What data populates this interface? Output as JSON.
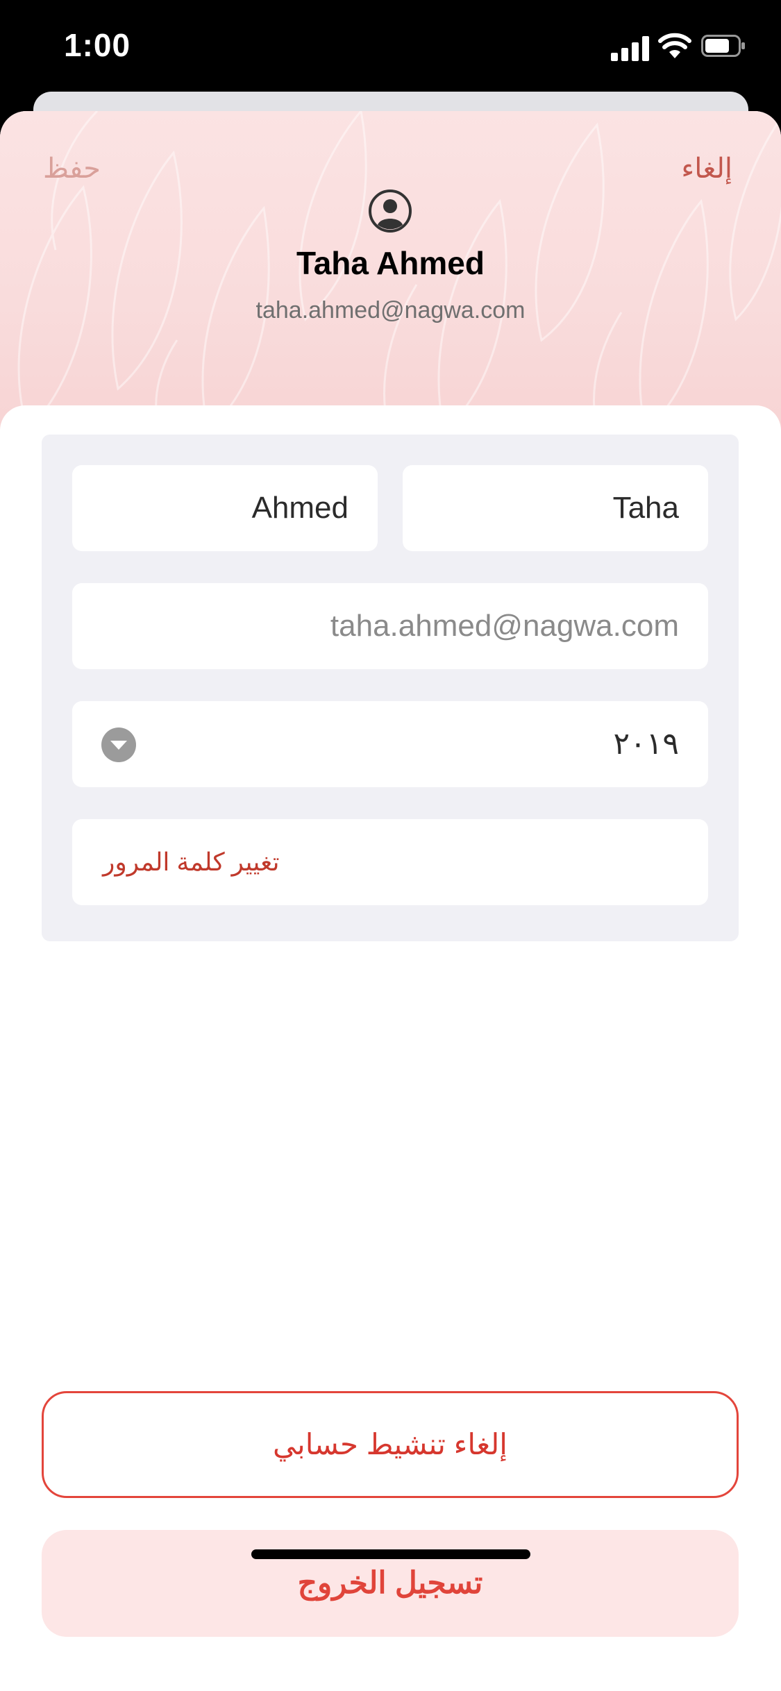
{
  "status_bar": {
    "time": "1:00"
  },
  "nav": {
    "save_label": "حفظ",
    "cancel_label": "إلغاء"
  },
  "profile": {
    "name": "Taha Ahmed",
    "email": "taha.ahmed@nagwa.com"
  },
  "form": {
    "first_name": "Taha",
    "last_name": "Ahmed",
    "email": "taha.ahmed@nagwa.com",
    "year": "٢٠١٩",
    "change_password_label": "تغيير كلمة المرور"
  },
  "actions": {
    "deactivate_label": "إلغاء تنشيط حسابي",
    "logout_label": "تسجيل الخروج"
  },
  "colors": {
    "accent": "#e0443a",
    "header_bg": "#f9dcdc",
    "logout_bg": "#fde6e6"
  },
  "icons": [
    "signal-icon",
    "wifi-icon",
    "battery-icon",
    "avatar-icon",
    "chevron-down-icon"
  ]
}
